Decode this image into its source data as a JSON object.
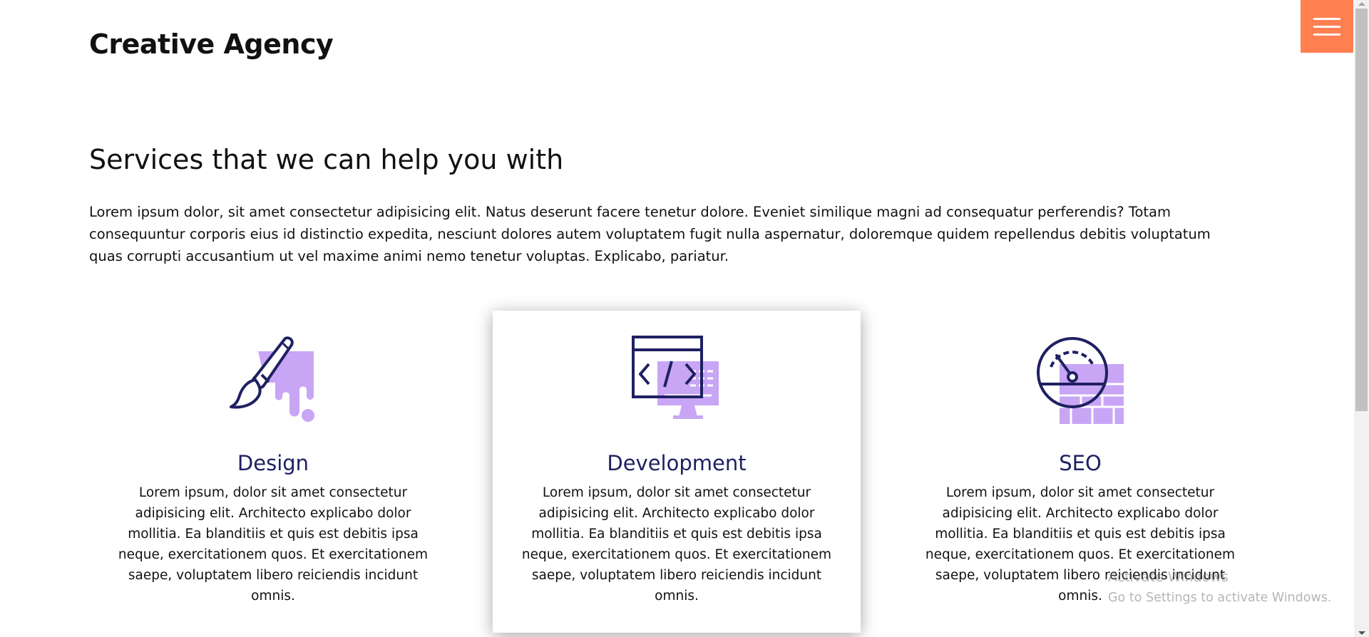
{
  "header": {
    "logo": "Creative Agency",
    "menu_icon": "hamburger-icon"
  },
  "colors": {
    "accent": "#ff7f50",
    "heading_navy": "#1f2062",
    "icon_purple": "#c8a6f5",
    "icon_navy": "#1f2062"
  },
  "services": {
    "title": "Services that we can help you with",
    "intro": "Lorem ipsum dolor, sit amet consectetur adipisicing elit. Natus deserunt facere tenetur dolore. Eveniet similique magni ad consequatur perferendis? Totam consequuntur corporis eius id distinctio expedita, nesciunt dolores autem voluptatem fugit nulla aspernatur, doloremque quidem repellendus debitis voluptatum quas corrupti accusantium ut vel maxime animi nemo tenetur voluptas. Explicabo, pariatur.",
    "cards": [
      {
        "icon": "paintbrush-icon",
        "title": "Design",
        "text": "Lorem ipsum, dolor sit amet consectetur adipisicing elit. Architecto explicabo dolor mollitia. Ea blanditiis et quis est debitis ipsa neque, exercitationem quos. Et exercitationem saepe, voluptatem libero reiciendis incidunt omnis."
      },
      {
        "icon": "code-monitor-icon",
        "title": "Development",
        "text": "Lorem ipsum, dolor sit amet consectetur adipisicing elit. Architecto explicabo dolor mollitia. Ea blanditiis et quis est debitis ipsa neque, exercitationem quos. Et exercitationem saepe, voluptatem libero reiciendis incidunt omnis."
      },
      {
        "icon": "speedometer-icon",
        "title": "SEO",
        "text": "Lorem ipsum, dolor sit amet consectetur adipisicing elit. Architecto explicabo dolor mollitia. Ea blanditiis et quis est debitis ipsa neque, exercitationem quos. Et exercitationem saepe, voluptatem libero reiciendis incidunt omnis."
      }
    ]
  },
  "watermark": {
    "line1": "Activate Windows",
    "line2": "Go to Settings to activate Windows."
  }
}
